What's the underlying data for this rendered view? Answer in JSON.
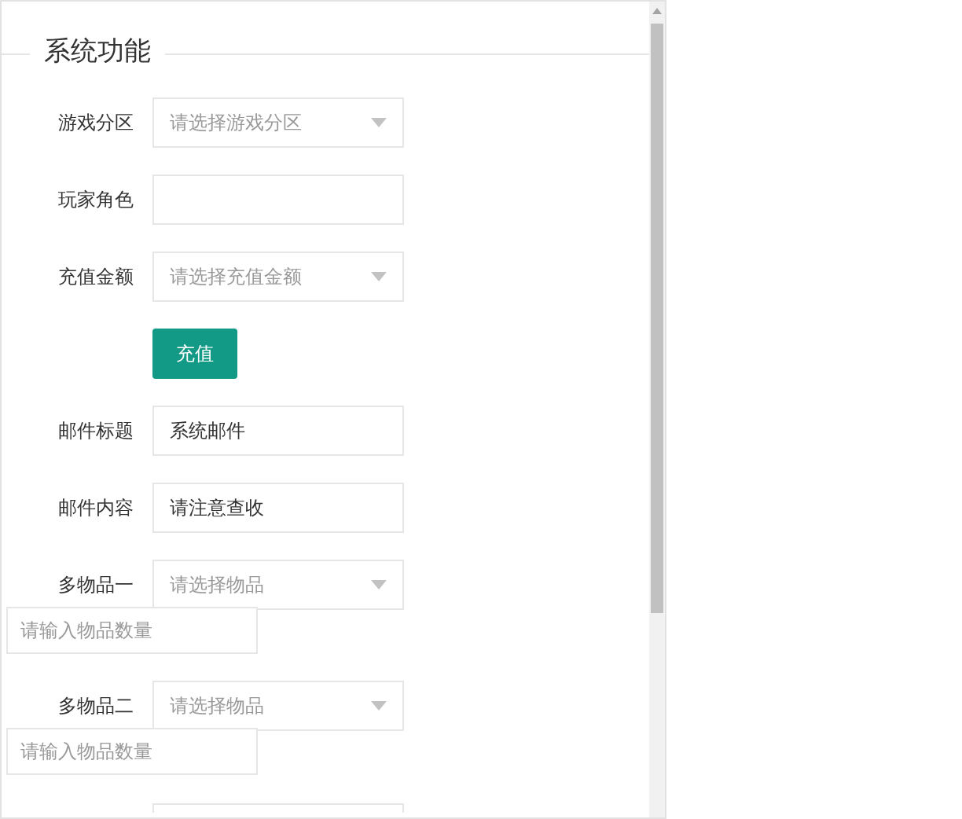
{
  "panel": {
    "legend": "系统功能",
    "rows": [
      {
        "kind": "select",
        "label": "游戏分区",
        "placeholder": "请选择游戏分区"
      },
      {
        "kind": "text",
        "label": "玩家角色"
      },
      {
        "kind": "select",
        "label": "充值金额",
        "placeholder": "请选择充值金额"
      },
      {
        "kind": "button",
        "text": "充值"
      },
      {
        "kind": "text",
        "label": "邮件标题",
        "value": "系统邮件"
      },
      {
        "kind": "text",
        "label": "邮件内容",
        "value": "请注意查收"
      },
      {
        "kind": "select",
        "label": "多物品一",
        "placeholder": "请选择物品"
      },
      {
        "kind": "quantity",
        "placeholder": "请输入物品数量"
      },
      {
        "kind": "select",
        "label": "多物品二",
        "placeholder": "请选择物品"
      },
      {
        "kind": "quantity",
        "placeholder": "请输入物品数量"
      },
      {
        "kind": "cut"
      }
    ]
  }
}
